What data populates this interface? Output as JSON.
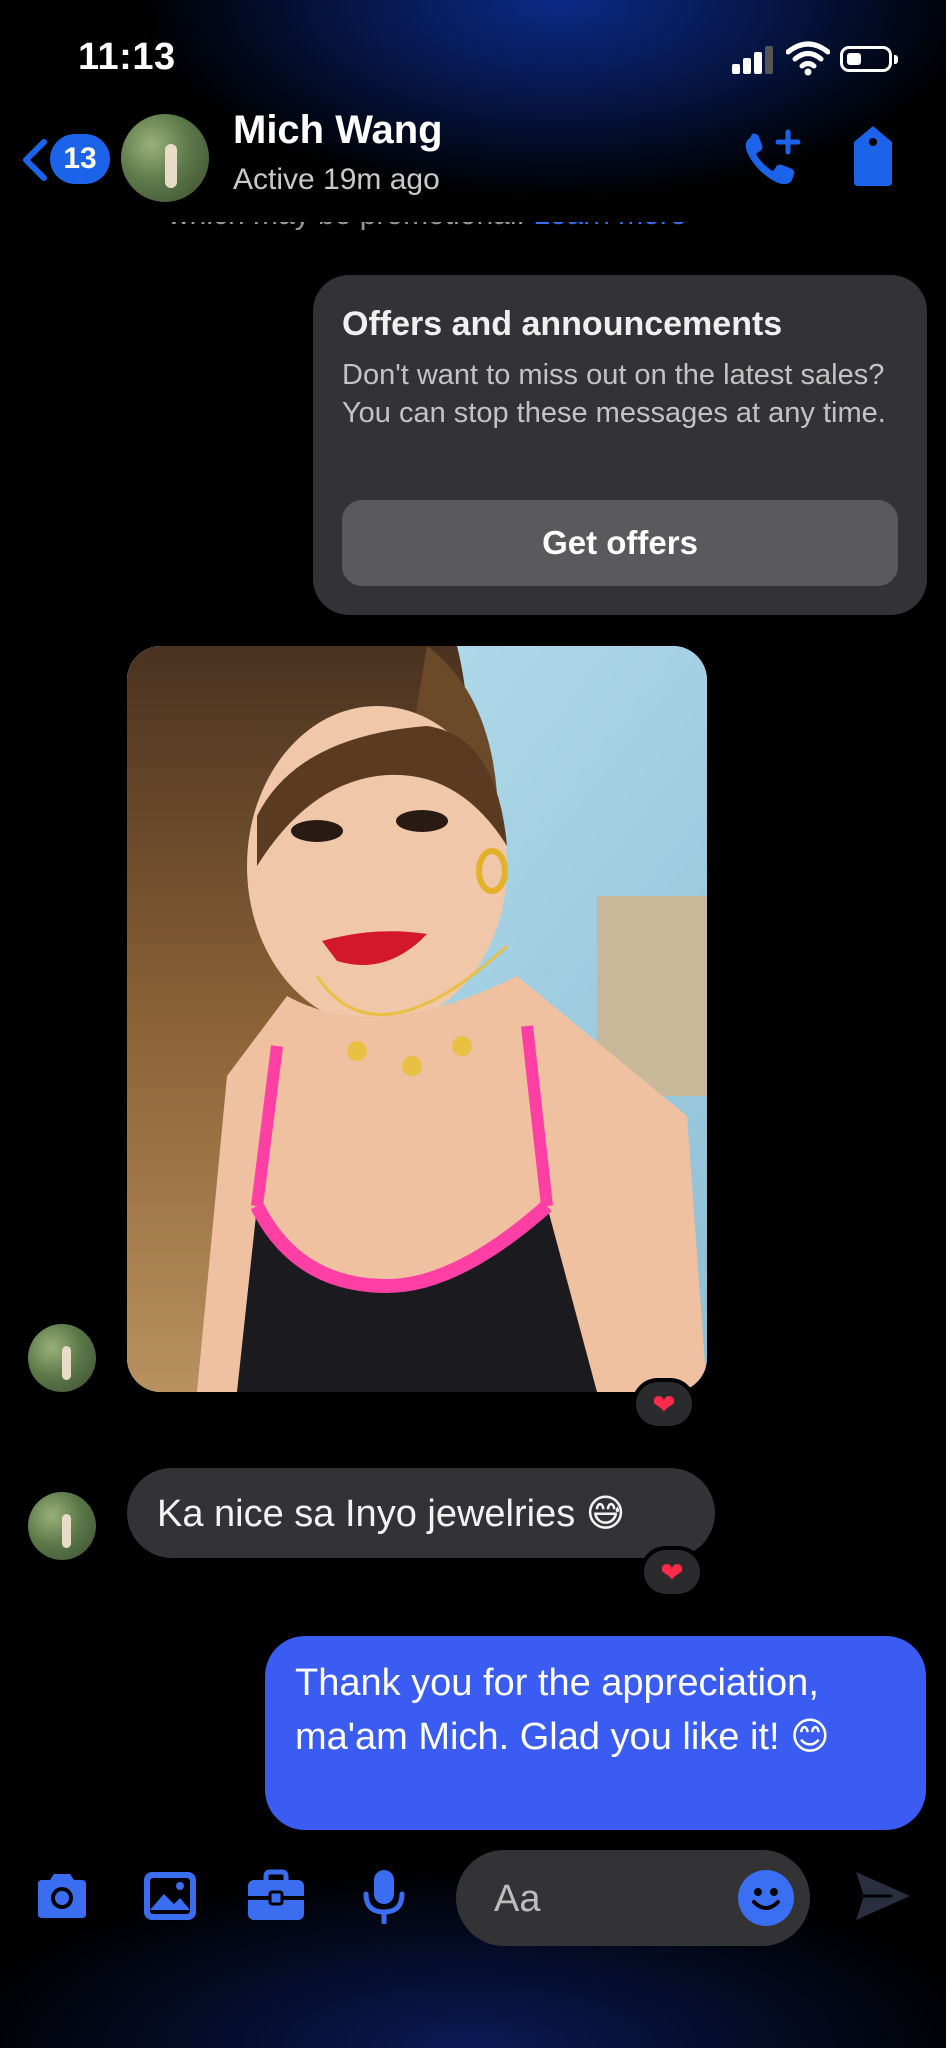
{
  "status_bar": {
    "time": "11:13"
  },
  "header": {
    "back_count": "13",
    "name": "Mich Wang",
    "status": "Active 19m ago"
  },
  "thread": {
    "cut_notice": "which may be promotional.",
    "cut_link": "Learn more",
    "offers_card": {
      "title": "Offers and announcements",
      "body": "Don't want to miss out on the latest sales? You can stop these messages at any time.",
      "button": "Get offers"
    },
    "photo_reaction": "❤",
    "incoming_text": "Ka nice sa Inyo jewelries 😅",
    "incoming_reaction": "❤",
    "outgoing_text": "Thank you for the appreciation, ma'am Mich. Glad you like it! 😊"
  },
  "composer": {
    "placeholder": "Aa"
  },
  "colors": {
    "accent": "#3a5cf2",
    "bubble_in": "#333335",
    "link": "#3a6df0"
  }
}
